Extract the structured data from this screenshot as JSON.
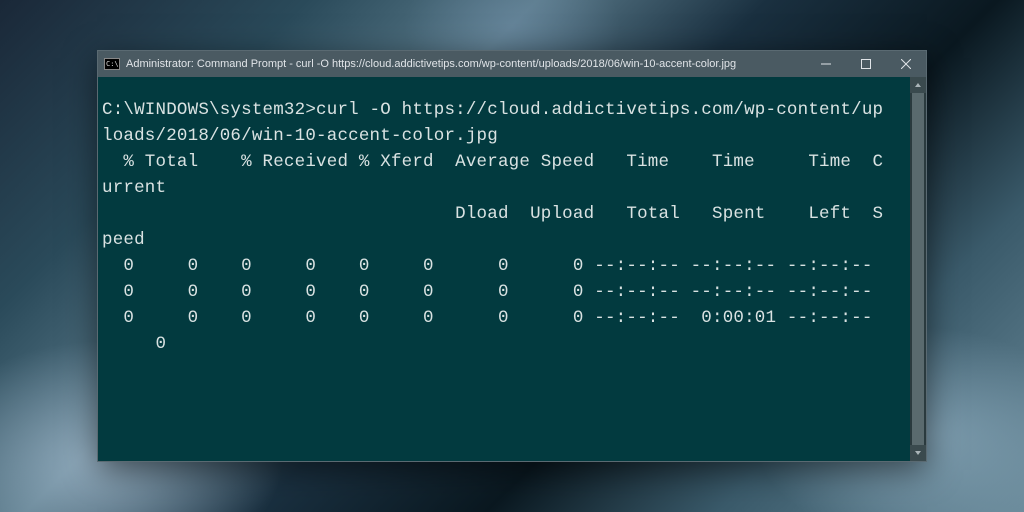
{
  "titlebar": {
    "icon_text": "C:\\",
    "title": "Administrator: Command Prompt - curl  -O https://cloud.addictivetips.com/wp-content/uploads/2018/06/win-10-accent-color.jpg"
  },
  "terminal": {
    "lines": [
      "C:\\WINDOWS\\system32>curl -O https://cloud.addictivetips.com/wp-content/up",
      "loads/2018/06/win-10-accent-color.jpg",
      "  % Total    % Received % Xferd  Average Speed   Time    Time     Time  C",
      "urrent",
      "                                 Dload  Upload   Total   Spent    Left  S",
      "peed",
      "  0     0    0     0    0     0      0      0 --:--:-- --:--:-- --:--:--",
      "  0     0    0     0    0     0      0      0 --:--:-- --:--:-- --:--:--",
      "  0     0    0     0    0     0      0      0 --:--:--  0:00:01 --:--:--",
      "     0"
    ]
  }
}
